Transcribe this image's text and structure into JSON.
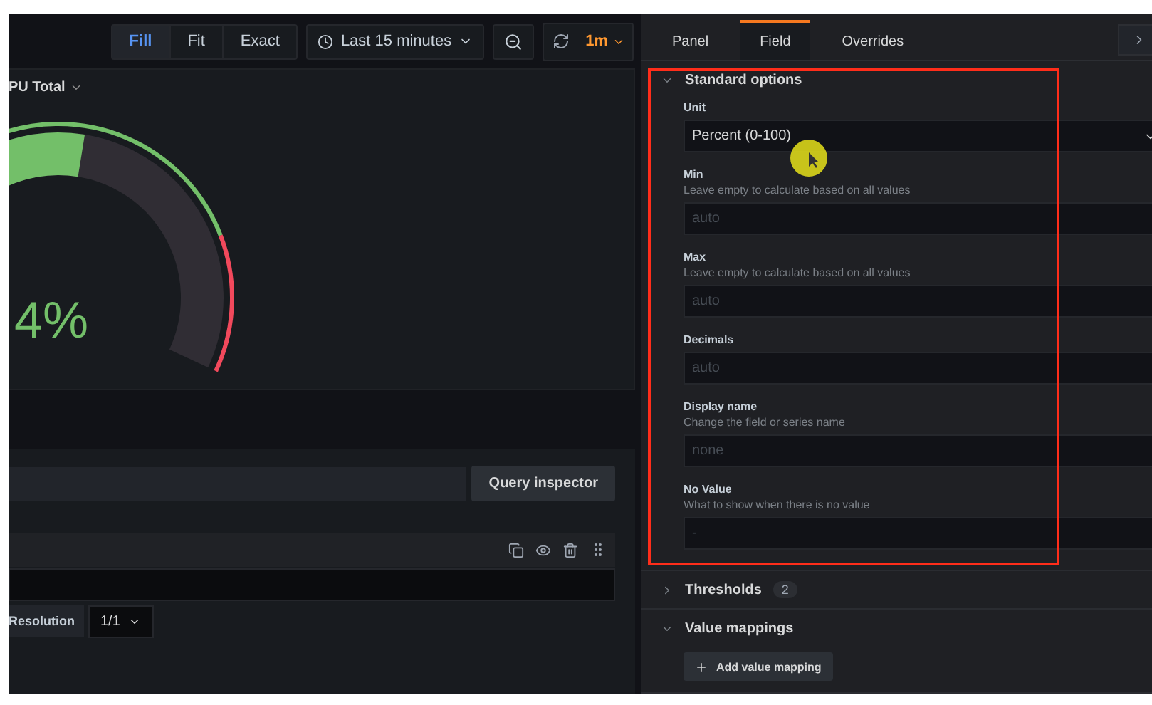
{
  "toolbar": {
    "fit_modes": [
      {
        "label": "Fill",
        "selected": true
      },
      {
        "label": "Fit",
        "selected": false
      },
      {
        "label": "Exact",
        "selected": false
      }
    ],
    "time_range": "Last 15 minutes",
    "refresh_interval": "1m"
  },
  "panel": {
    "title": "PU Total",
    "gauge": {
      "value": "4%",
      "level": 0.54
    }
  },
  "query": {
    "inspector_button": "Query inspector",
    "resolution_label": "Resolution",
    "resolution_value": "1/1"
  },
  "editor": {
    "tabs": [
      {
        "label": "Panel",
        "selected": false
      },
      {
        "label": "Field",
        "selected": true
      },
      {
        "label": "Overrides",
        "selected": false
      }
    ],
    "sections": [
      {
        "title": "Standard options",
        "expanded": true,
        "fields": [
          {
            "kind": "select",
            "label": "Unit",
            "value": "Percent (0-100)"
          },
          {
            "kind": "input",
            "label": "Min",
            "description": "Leave empty to calculate based on all values",
            "placeholder": "auto"
          },
          {
            "kind": "input",
            "label": "Max",
            "description": "Leave empty to calculate based on all values",
            "placeholder": "auto"
          },
          {
            "kind": "input",
            "label": "Decimals",
            "placeholder": "auto"
          },
          {
            "kind": "input",
            "label": "Display name",
            "description": "Change the field or series name",
            "placeholder": "none"
          },
          {
            "kind": "input",
            "label": "No Value",
            "description": "What to show when there is no value",
            "placeholder": "-"
          }
        ]
      },
      {
        "title": "Thresholds",
        "expanded": false,
        "count": "2"
      },
      {
        "title": "Value mappings",
        "expanded": true,
        "button": "Add value mapping"
      }
    ]
  }
}
